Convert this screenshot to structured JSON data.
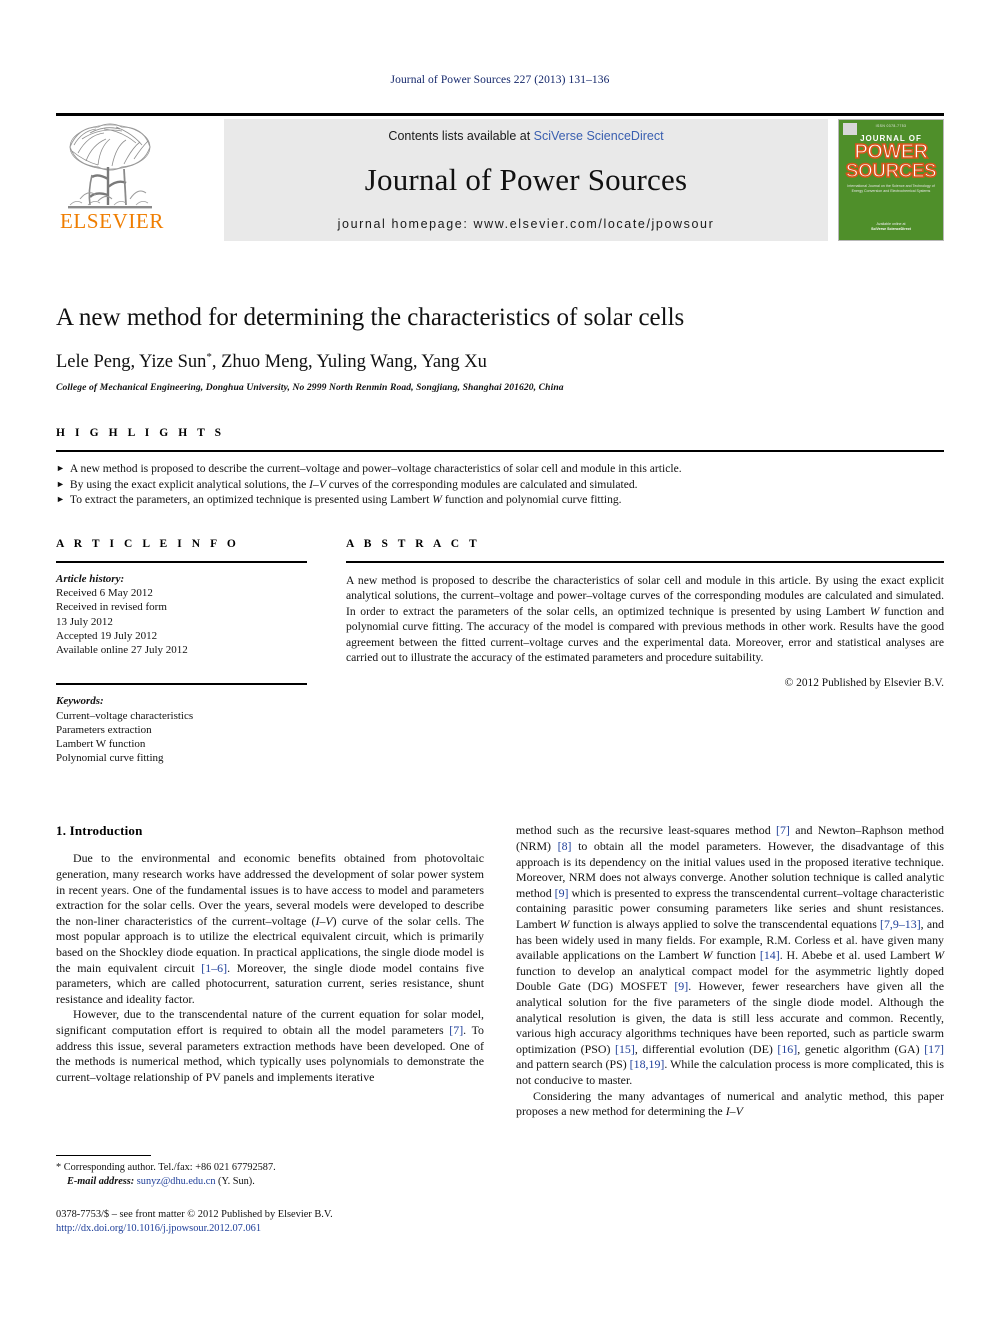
{
  "running_head": "Journal of Power Sources 227 (2013) 131–136",
  "masthead": {
    "publisher_name": "ELSEVIER",
    "contents_prefix": "Contents lists available at ",
    "contents_link": "SciVerse ScienceDirect",
    "journal_title": "Journal of Power Sources",
    "homepage": "journal homepage: www.elsevier.com/locate/jpowsour",
    "cover": {
      "top_tag": "ISSN 0378-7753",
      "line1": "JOURNAL OF",
      "line2": "POWER",
      "line3": "SOURCES",
      "subtitle": "International Journal on the Science and Technology of Energy Conversion and Electrochemical Systems",
      "footer_label": "Available online at",
      "footer_brand": "SciVerse ScienceDirect"
    },
    "link_color": "#3a5fb0",
    "brand_color": "#ef7d00",
    "cover_bg": "#4f8f2a"
  },
  "article": {
    "title": "A new method for determining the characteristics of solar cells",
    "authors_pre": "Lele Peng, Yize Sun",
    "authors_star": "*",
    "authors_post": ", Zhuo Meng, Yuling Wang, Yang Xu",
    "affiliation": "College of Mechanical Engineering, Donghua University, No 2999 North Renmin Road, Songjiang, Shanghai 201620, China"
  },
  "highlights": {
    "heading": "H I G H L I G H T S",
    "bullet_glyph": "►",
    "items": [
      {
        "pre": "A new method is proposed to describe the current–voltage and power–voltage characteristics of solar cell and module in this article.",
        "italic": "",
        "post": ""
      },
      {
        "pre": "By using the exact explicit analytical solutions, the ",
        "italic": "I–V",
        "post": " curves of the corresponding modules are calculated and simulated."
      },
      {
        "pre": "To extract the parameters, an optimized technique is presented using Lambert ",
        "italic": "W",
        "post": " function and polynomial curve fitting."
      }
    ]
  },
  "article_info": {
    "heading": "A R T I C L E   I N F O",
    "history_label": "Article history:",
    "history": [
      "Received 6 May 2012",
      "Received in revised form",
      "13 July 2012",
      "Accepted 19 July 2012",
      "Available online 27 July 2012"
    ],
    "keywords_label": "Keywords:",
    "keywords": [
      "Current–voltage characteristics",
      "Parameters extraction",
      "Lambert W function",
      "Polynomial curve fitting"
    ]
  },
  "abstract": {
    "heading": "A B S T R A C T",
    "part1": "A new method is proposed to describe the characteristics of solar cell and module in this article. By using the exact explicit analytical solutions, the current–voltage and power–voltage curves of the corresponding modules are calculated and simulated. In order to extract the parameters of the solar cells, an optimized technique is presented by using Lambert ",
    "italic1": "W",
    "part2": " function and polynomial curve fitting. The accuracy of the model is compared with previous methods in other work. Results have the good agreement between the fitted current–voltage curves and the experimental data. Moreover, error and statistical analyses are carried out to illustrate the accuracy of the estimated parameters and procedure suitability.",
    "copyright": "© 2012 Published by Elsevier B.V."
  },
  "introduction": {
    "heading": "1.  Introduction",
    "left_p1_a": "Due to the environmental and economic benefits obtained from photovoltaic generation, many research works have addressed the development of solar power system in recent years. One of the fundamental issues is to have access to model and parameters extraction for the solar cells. Over the years, several models were developed to describe the non-liner characteristics of the current–voltage (",
    "left_p1_i": "I–V",
    "left_p1_b": ") curve of the solar cells. The most popular approach is to utilize the electrical equivalent circuit, which is primarily based on the Shockley diode equation. In practical applications, the single diode model is the main equivalent circuit ",
    "left_p1_ref1": "[1–6]",
    "left_p1_c": ". Moreover, the single diode model contains five parameters, which are called photocurrent, saturation current, series resistance, shunt resistance and ideality factor.",
    "left_p2_a": "However, due to the transcendental nature of the current equation for solar model, significant computation effort is required to obtain all the model parameters ",
    "left_p2_ref": "[7]",
    "left_p2_b": ". To address this issue, several parameters extraction methods have been developed. One of the methods is numerical method, which typically uses polynomials to demonstrate the current–voltage relationship of PV panels and implements iterative",
    "right_p1_a": "method such as the recursive least-squares method ",
    "right_p1_r1": "[7]",
    "right_p1_b": " and Newton–Raphson method (NRM) ",
    "right_p1_r2": "[8]",
    "right_p1_c": " to obtain all the model parameters. However, the disadvantage of this approach is its dependency on the initial values used in the proposed iterative technique. Moreover, NRM does not always converge. Another solution technique is called analytic method ",
    "right_p1_r3": "[9]",
    "right_p1_d": " which is presented to express the transcendental current–voltage characteristic containing parasitic power consuming parameters like series and shunt resistances. Lambert ",
    "right_p1_i1": "W",
    "right_p1_e": " function is always applied to solve the transcendental equations ",
    "right_p1_r4": "[7,9–13]",
    "right_p1_f": ", and has been widely used in many fields. For example, R.M. Corless et al. have given many available applications on the Lambert ",
    "right_p1_i2": "W",
    "right_p1_g": " function ",
    "right_p1_r5": "[14]",
    "right_p1_h": ". H. Abebe et al. used Lambert ",
    "right_p1_i3": "W",
    "right_p1_j": " function to develop an analytical compact model for the asymmetric lightly doped Double Gate (DG) MOSFET ",
    "right_p1_r6": "[9]",
    "right_p1_k": ". However, fewer researchers have given all the analytical solution for the five parameters of the single diode model. Although the analytical resolution is given, the data is still less accurate and common. Recently, various high accuracy algorithms techniques have been reported, such as particle swarm optimization (PSO) ",
    "right_p1_r7": "[15]",
    "right_p1_l": ", differential evolution (DE) ",
    "right_p1_r8": "[16]",
    "right_p1_m": ", genetic algorithm (GA) ",
    "right_p1_r9": "[17]",
    "right_p1_n": " and pattern search (PS) ",
    "right_p1_r10": "[18,19]",
    "right_p1_o": ". While the calculation process is more complicated, this is not conducive to master.",
    "right_p2_a": "Considering the many advantages of numerical and analytic method, this paper proposes a new method for determining the ",
    "right_p2_i": "I–V"
  },
  "footnotes": {
    "corresponding": "* Corresponding author. Tel./fax: +86 021 67792587.",
    "email_label": "E-mail address:",
    "email": "sunyz@dhu.edu.cn",
    "email_suffix": " (Y. Sun).",
    "issn_line": "0378-7753/$ – see front matter © 2012 Published by Elsevier B.V.",
    "doi": "http://dx.doi.org/10.1016/j.jpowsour.2012.07.061",
    "link_color": "#20409a"
  }
}
